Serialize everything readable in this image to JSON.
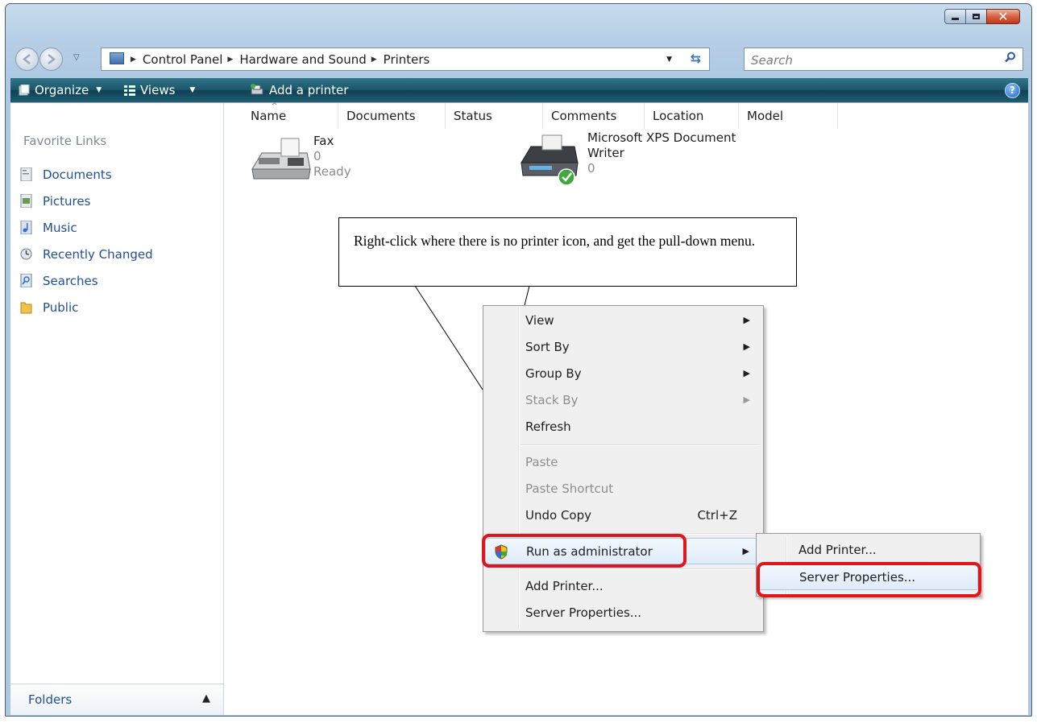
{
  "address_bar": {
    "crumbs": [
      "Control Panel",
      "Hardware and Sound",
      "Printers"
    ]
  },
  "search": {
    "placeholder": "Search"
  },
  "toolbar": {
    "organize_label": "Organize",
    "views_label": "Views",
    "add_printer_label": "Add a printer"
  },
  "nav_pane": {
    "title": "Favorite Links",
    "items": [
      {
        "label": "Documents",
        "icon": "documents-icon"
      },
      {
        "label": "Pictures",
        "icon": "pictures-icon"
      },
      {
        "label": "Music",
        "icon": "music-icon"
      },
      {
        "label": "Recently Changed",
        "icon": "recently-changed-icon"
      },
      {
        "label": "Searches",
        "icon": "searches-icon"
      },
      {
        "label": "Public",
        "icon": "public-folder-icon"
      }
    ],
    "folders_label": "Folders"
  },
  "columns": [
    "Name",
    "Documents",
    "Status",
    "Comments",
    "Location",
    "Model"
  ],
  "printers": [
    {
      "name": "Fax",
      "documents": "0",
      "status": "Ready"
    },
    {
      "name_line1": "Microsoft XPS Document",
      "name_line2": "Writer",
      "documents": "0"
    }
  ],
  "callout": {
    "text": "Right-click where there is no printer icon, and get the pull-down menu."
  },
  "context_menu": {
    "items": [
      {
        "label": "View"
      },
      {
        "label": "Sort By"
      },
      {
        "label": "Group By"
      },
      {
        "label": "Stack By"
      },
      {
        "label": "Refresh"
      },
      {
        "label": "Paste"
      },
      {
        "label": "Paste Shortcut"
      },
      {
        "label": "Undo Copy",
        "shortcut": "Ctrl+Z"
      },
      {
        "label": "Run as administrator"
      },
      {
        "label": "Add Printer..."
      },
      {
        "label": "Server Properties..."
      }
    ]
  },
  "submenu": {
    "items": [
      {
        "label": "Add Printer..."
      },
      {
        "label": "Server Properties..."
      }
    ]
  },
  "colors": {
    "highlight": "#e0161b",
    "command_bar": "#1b5468",
    "link": "#1f4f94"
  }
}
